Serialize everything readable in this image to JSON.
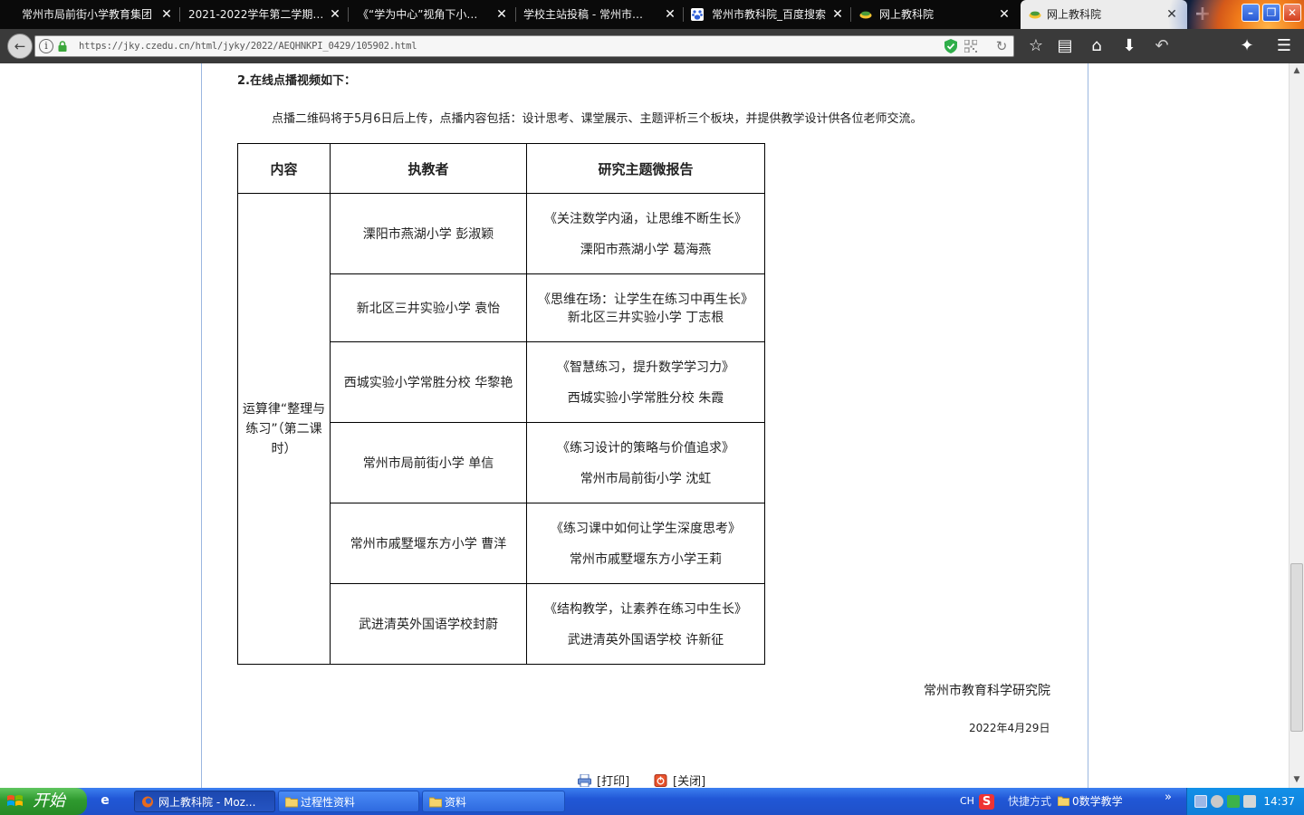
{
  "browser": {
    "tabs": [
      {
        "label": "常州市局前街小学教育集团",
        "close": "✕"
      },
      {
        "label": "2021-2022学年第二学期…",
        "close": "✕"
      },
      {
        "label": "《“学为中心”视角下小…",
        "close": "✕"
      },
      {
        "label": "学校主站投稿 - 常州市…",
        "close": "✕"
      },
      {
        "label": "常州市教科院_百度搜索",
        "close": "✕"
      },
      {
        "label": "网上教科院",
        "close": "✕"
      },
      {
        "label": "网上教科院",
        "close": "✕",
        "active": true
      }
    ],
    "new_tab": "+",
    "url": "https://jky.czedu.cn/html/jyky/2022/AEQHNKPI_0429/105902.html",
    "window_controls": {
      "minimize": "–",
      "maximize": "❐",
      "close": "✕"
    },
    "toolbar_icons": [
      "bookmark-star-icon",
      "reader-view-icon",
      "home-icon",
      "download-icon",
      "undo-icon",
      "extension-icon",
      "menu-icon"
    ]
  },
  "article": {
    "section_heading": "2.在线点播视频如下：",
    "intro": "点播二维码将于5月6日后上传，点播内容包括：设计思考、课堂展示、主题评析三个板块，并提供教学设计供各位老师交流。",
    "table": {
      "headers": [
        "内容",
        "执教者",
        "研究主题微报告"
      ],
      "merged_content": "运算律“整理与练习”（第二课时）",
      "rows": [
        {
          "teacher": "溧阳市燕湖小学  彭淑颖",
          "report_title": "《关注数学内涵，让思维不断生长》",
          "report_author": "溧阳市燕湖小学    葛海燕"
        },
        {
          "teacher": "新北区三井实验小学    袁怡",
          "report_title": "《思维在场：让学生在练习中再生长》",
          "report_author": "新北区三井实验小学    丁志根"
        },
        {
          "teacher": "西城实验小学常胜分校  华黎艳",
          "report_title": "《智慧练习，提升数学学习力》",
          "report_author": "西城实验小学常胜分校    朱霞"
        },
        {
          "teacher": "常州市局前街小学      单信",
          "report_title": "《练习设计的策略与价值追求》",
          "report_author": "常州市局前街小学  沈虹"
        },
        {
          "teacher": "常州市戚墅堰东方小学    曹洋",
          "report_title": "《练习课中如何让学生深度思考》",
          "report_author": "常州市戚墅堰东方小学王莉"
        },
        {
          "teacher": "武进清英外国语学校封蔚",
          "report_title": "《结构教学，让素养在练习中生长》",
          "report_author": "武进清英外国语学校    许新征"
        }
      ]
    },
    "signature_org": "常州市教育科学研究院",
    "signature_date": "2022年4月29日",
    "print_label": "[打印]",
    "close_label": "[关闭]"
  },
  "taskbar": {
    "start": "开始",
    "buttons": [
      {
        "label": "网上教科院 - Moz...",
        "active": true
      },
      {
        "label": "过程性资料"
      },
      {
        "label": "资料"
      }
    ],
    "ime": "CH",
    "shortcut_label": "快捷方式",
    "folder_shortcut": "0数学教学",
    "chevron": "»",
    "clock": "14:37"
  },
  "colors": {
    "tab_strip": "#0a0a0a",
    "nav_bar": "#3a3a3a",
    "taskbar_blue": "#2157d6",
    "start_green": "#2f9a2f",
    "page_border": "#9bb7e0"
  }
}
